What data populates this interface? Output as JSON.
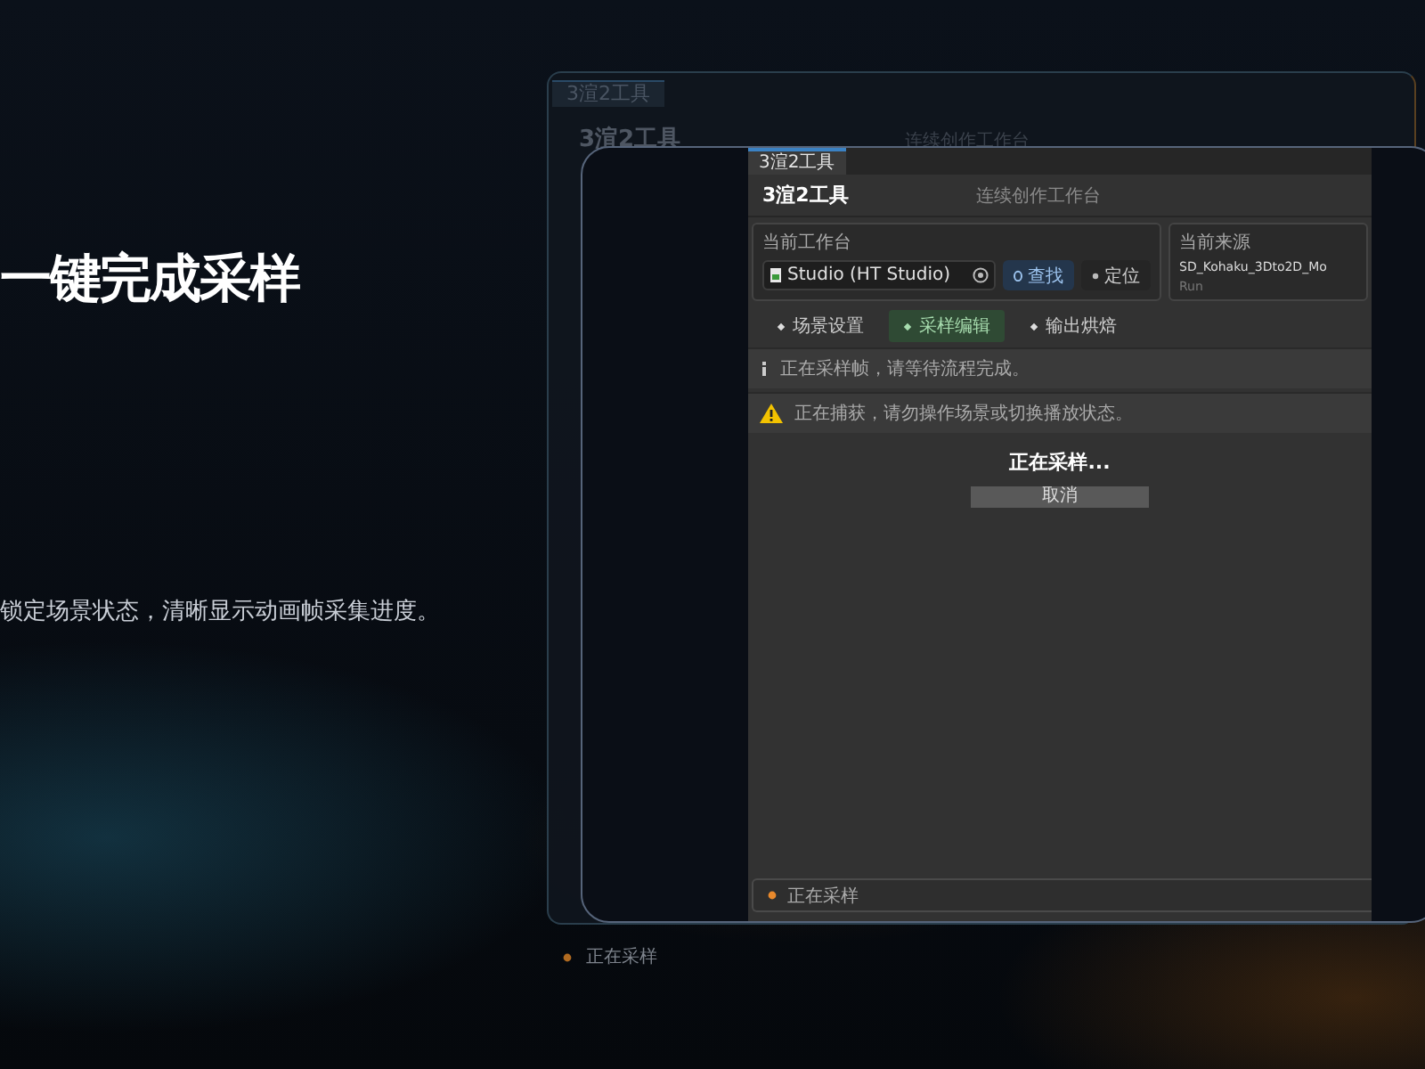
{
  "slide": {
    "headline": "一键完成采样",
    "description": "锁定场景状态，清晰显示动画帧采集进度。"
  },
  "back_window": {
    "tab": "3渲2工具",
    "title": "3渲2工具",
    "subtitle": "连续创作工作台",
    "reflection_status": "正在采样"
  },
  "app_window": {
    "tab": "3渲2工具",
    "title": "3渲2工具",
    "subtitle": "连续创作工作台",
    "workspace": {
      "label": "当前工作台",
      "value": "Studio (HT Studio)",
      "buttons": [
        {
          "label": "查找",
          "kind": "primary"
        },
        {
          "label": "定位",
          "kind": "secondary"
        }
      ]
    },
    "source": {
      "label": "当前来源",
      "value": "SD_Kohaku_3Dto2D_Mo",
      "sub": "Run"
    },
    "tabs": [
      {
        "label": "场景设置",
        "selected": false
      },
      {
        "label": "采样编辑",
        "selected": true
      },
      {
        "label": "输出烘焙",
        "selected": false
      }
    ],
    "messages": [
      {
        "kind": "info",
        "text": "正在采样帧，请等待流程完成。"
      },
      {
        "kind": "warning",
        "text": "正在捕获，请勿操作场景或切换播放状态。"
      }
    ],
    "progress": {
      "title": "正在采样...",
      "button": "取消"
    },
    "status_bar": {
      "text": "正在采样"
    }
  }
}
